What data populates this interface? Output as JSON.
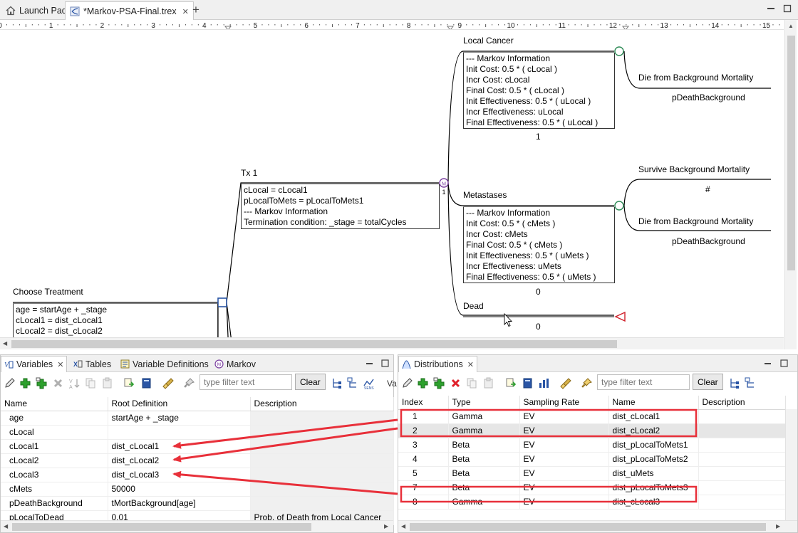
{
  "tabs": [
    {
      "label": "Launch Pad",
      "icon": "home-icon"
    },
    {
      "label": "*Markov-PSA-Final.trex",
      "icon": "tree-file-icon"
    }
  ],
  "ruler": {
    "numbers": [
      "0",
      "1",
      "2",
      "3",
      "4",
      "5",
      "6",
      "7",
      "8",
      "9",
      "10",
      "11",
      "12",
      "13",
      "14",
      "15"
    ]
  },
  "tree": {
    "choose_treatment": {
      "label": "Choose Treatment",
      "lines": [
        "age = startAge + _stage",
        "cLocal1 = dist_cLocal1",
        "cLocal2 = dist_cLocal2"
      ]
    },
    "tx1": {
      "label": "Tx 1",
      "lines": [
        "cLocal = cLocal1",
        "pLocalToMets = pLocalToMets1",
        "--- Markov Information",
        "Termination condition: _stage = totalCycles"
      ],
      "markov_badge": "M",
      "markov_index": "1"
    },
    "local_cancer": {
      "label": "Local Cancer",
      "lines": [
        "--- Markov Information",
        "Init Cost: 0.5 * ( cLocal )",
        "Incr Cost: cLocal",
        "Final Cost: 0.5 * ( cLocal )",
        "Init Effectiveness: 0.5 * ( uLocal )",
        "Incr Effectiveness: uLocal",
        "Final Effectiveness: 0.5 * ( uLocal )"
      ],
      "prob": "1"
    },
    "metastases": {
      "label": "Metastases",
      "lines": [
        "--- Markov Information",
        "Init Cost: 0.5 * ( cMets )",
        "Incr Cost: cMets",
        "Final Cost: 0.5 * ( cMets )",
        "Init Effectiveness: 0.5 * ( uMets )",
        "Incr Effectiveness: uMets",
        "Final Effectiveness: 0.5 * ( uMets )"
      ],
      "prob": "0"
    },
    "dead": {
      "label": "Dead",
      "prob": "0"
    },
    "die_bg_1": {
      "label": "Die from Background Mortality",
      "prob": "pDeathBackground"
    },
    "survive_bg": {
      "label": "Survive Background Mortality",
      "prob": "#"
    },
    "die_bg_2": {
      "label": "Die from Background Mortality",
      "prob": "pDeathBackground"
    }
  },
  "variables_panel": {
    "tabs": [
      {
        "label": "Variables",
        "icon": "variables-icon",
        "closable": true
      },
      {
        "label": "Tables",
        "icon": "tables-icon"
      },
      {
        "label": "Variable Definitions",
        "icon": "variable-definitions-icon"
      },
      {
        "label": "Markov",
        "icon": "markov-icon"
      }
    ],
    "filter_placeholder": "type filter text",
    "clear_label": "Clear",
    "more_label": "Va",
    "columns": [
      "Name",
      "Root Definition",
      "Description"
    ],
    "rows": [
      {
        "name": "age",
        "def": "startAge + _stage",
        "desc": ""
      },
      {
        "name": "cLocal",
        "def": "",
        "desc": ""
      },
      {
        "name": "cLocal1",
        "def": "dist_cLocal1",
        "desc": ""
      },
      {
        "name": "cLocal2",
        "def": "dist_cLocal2",
        "desc": ""
      },
      {
        "name": "cLocal3",
        "def": "dist_cLocal3",
        "desc": ""
      },
      {
        "name": "cMets",
        "def": "50000",
        "desc": ""
      },
      {
        "name": "pDeathBackground",
        "def": "tMortBackground[age]",
        "desc": ""
      },
      {
        "name": "pLocalToDead",
        "def": "0.01",
        "desc": "Prob. of Death from Local Cancer"
      }
    ]
  },
  "distributions_panel": {
    "tabs": [
      {
        "label": "Distributions",
        "icon": "distributions-icon",
        "closable": true
      }
    ],
    "filter_placeholder": "type filter text",
    "clear_label": "Clear",
    "columns": [
      "Index",
      "Type",
      "Sampling Rate",
      "Name",
      "Description"
    ],
    "rows": [
      {
        "index": "1",
        "type": "Gamma",
        "rate": "EV",
        "name": "dist_cLocal1",
        "desc": ""
      },
      {
        "index": "2",
        "type": "Gamma",
        "rate": "EV",
        "name": "dist_cLocal2",
        "desc": ""
      },
      {
        "index": "3",
        "type": "Beta",
        "rate": "EV",
        "name": "dist_pLocalToMets1",
        "desc": ""
      },
      {
        "index": "4",
        "type": "Beta",
        "rate": "EV",
        "name": "dist_pLocalToMets2",
        "desc": ""
      },
      {
        "index": "5",
        "type": "Beta",
        "rate": "EV",
        "name": "dist_uMets",
        "desc": ""
      },
      {
        "index": "7",
        "type": "Beta",
        "rate": "EV",
        "name": "dist_pLocalToMets3",
        "desc": ""
      },
      {
        "index": "8",
        "type": "Gamma",
        "rate": "EV",
        "name": "dist_cLocal3",
        "desc": ""
      }
    ]
  },
  "colors": {
    "annotation_red": "#e8303a",
    "markov_node": "#7b3fa0",
    "chance_node": "#2e8b57",
    "decision_node": "#2a55a5",
    "terminal_node": "#d0202a"
  }
}
